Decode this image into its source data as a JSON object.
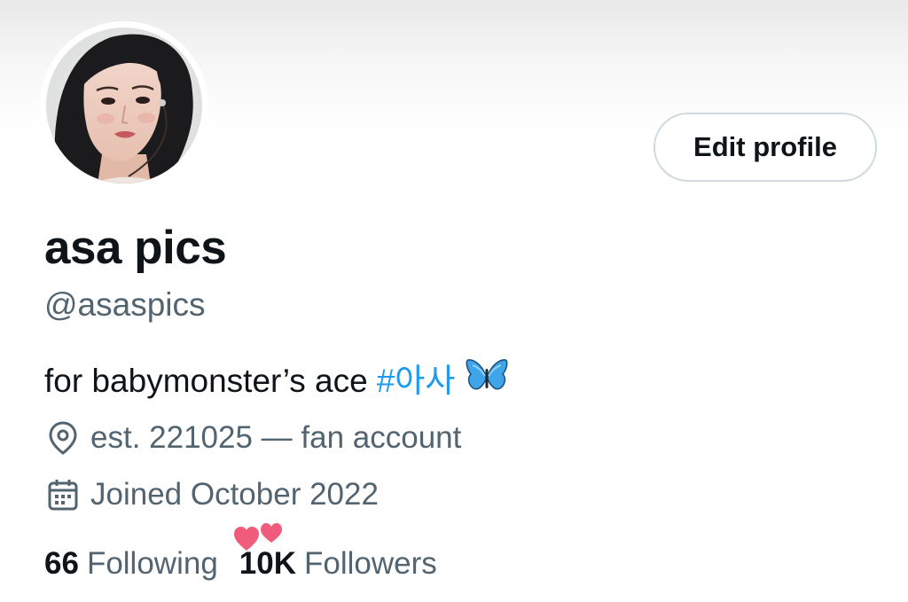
{
  "profile": {
    "display_name": "asa pics",
    "handle": "@asaspics",
    "bio_text": "for babymonster’s ace",
    "bio_hashtag": "#아사",
    "bio_emoji": "butterfly-icon",
    "location": "est. 221025 — fan account",
    "joined": "Joined October 2022",
    "avatar": "profile-photo"
  },
  "actions": {
    "edit_profile_label": "Edit profile"
  },
  "stats": {
    "following_count": "66",
    "following_label": "Following",
    "followers_count": "10K",
    "followers_label": "Followers"
  },
  "colors": {
    "text_primary": "#0f1419",
    "text_secondary": "#536471",
    "accent": "#1d9bf0",
    "border": "#cfd9de",
    "hearts": "#f25c7c"
  }
}
